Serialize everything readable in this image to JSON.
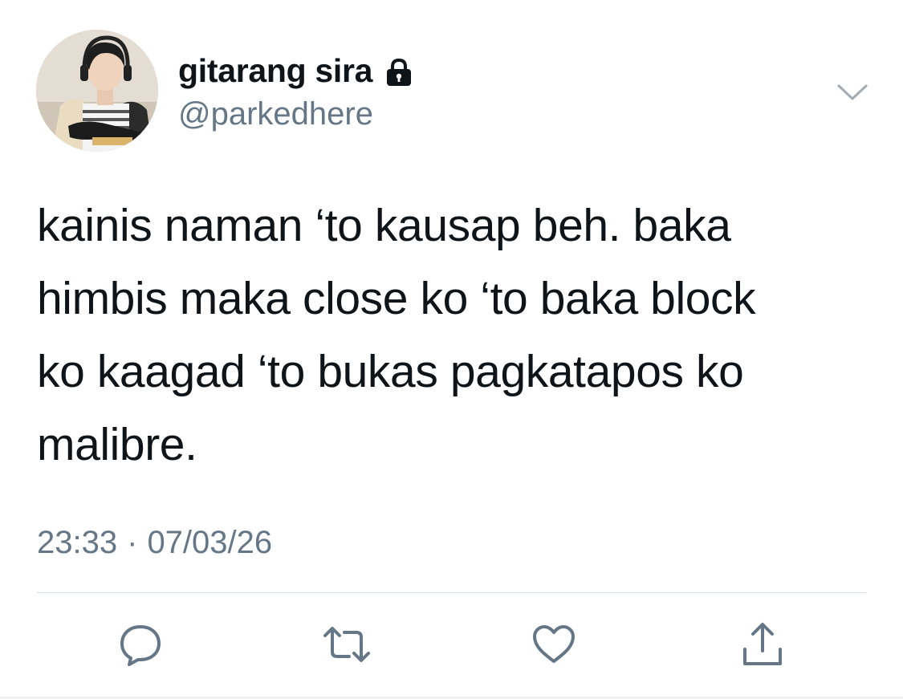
{
  "user": {
    "display_name": "gitarang sira",
    "handle": "@parkedhere",
    "protected_icon": "lock-icon",
    "avatar_icon": "profile-photo"
  },
  "menu": {
    "icon": "chevron-down-icon"
  },
  "tweet": {
    "lines": [
      "kainis naman ‘to kausap beh. baka",
      "himbis maka close ko ‘to baka block",
      "ko kaagad ‘to bukas pagkatapos ko",
      "malibre."
    ],
    "time": "23:33",
    "separator": "·",
    "date": "07/03/26"
  },
  "actions": [
    {
      "icon": "reply-icon"
    },
    {
      "icon": "retweet-icon"
    },
    {
      "icon": "like-icon"
    },
    {
      "icon": "share-icon"
    }
  ],
  "colors": {
    "text": "#0f1419",
    "secondary": "#657786",
    "icon": "#657786",
    "divider": "#d6dce0"
  }
}
